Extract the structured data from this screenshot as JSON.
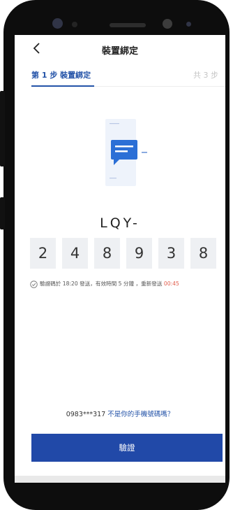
{
  "header": {
    "title": "裝置綁定"
  },
  "steps": {
    "current": "第 1 步  裝置綁定",
    "total": "共 3 步"
  },
  "code": {
    "prefix": "LQY-",
    "digits": [
      "2",
      "4",
      "8",
      "9",
      "3",
      "8"
    ]
  },
  "note": {
    "text": "驗證碼於 18:20 發送，有效時間 5 分鐘 ，重新發送 ",
    "timer": "00:45"
  },
  "phone_line": {
    "number": "0983***317 ",
    "link": "不是你的手機號碼嗎？"
  },
  "verify_button": {
    "label": "驗證"
  },
  "colors": {
    "accent": "#2453a8",
    "button": "#2149a8",
    "timer": "#e15b4a"
  }
}
